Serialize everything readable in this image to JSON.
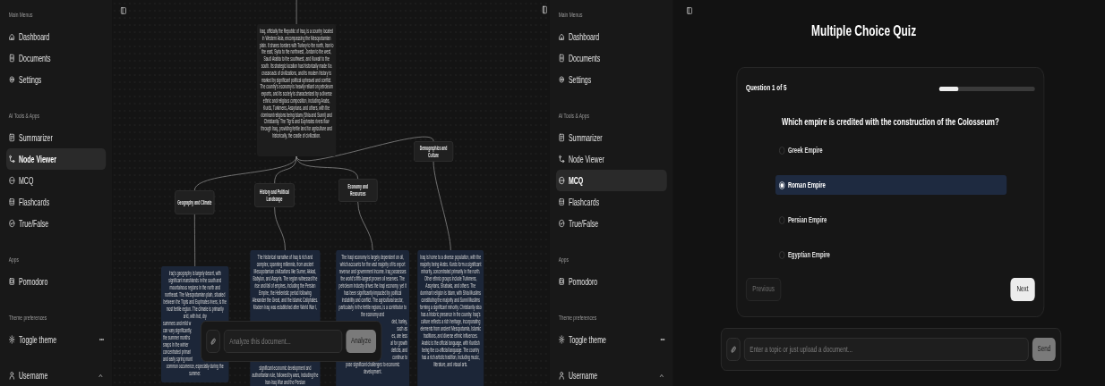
{
  "screens": [
    {
      "kind": "node_viewer",
      "sidebar": {
        "sections": [
          {
            "title": "Main Menus",
            "items": [
              {
                "label": "Dashboard",
                "selected": false
              },
              {
                "label": "Documents",
                "selected": false
              },
              {
                "label": "Settings",
                "selected": false
              }
            ]
          },
          {
            "title": "AI Tools & Apps",
            "items": [
              {
                "label": "Summarizer",
                "selected": false
              },
              {
                "label": "Node Viewer",
                "selected": true
              },
              {
                "label": "MCQ",
                "selected": false
              },
              {
                "label": "Flashcards",
                "selected": false
              },
              {
                "label": "True/False",
                "selected": false
              }
            ]
          },
          {
            "title": "Apps",
            "items": [
              {
                "label": "Pomodoro",
                "selected": false
              }
            ]
          },
          {
            "title": "Theme preferences",
            "items": [
              {
                "label": "Toggle theme",
                "selected": false
              }
            ]
          }
        ],
        "account": {
          "label": "Username"
        }
      },
      "canvas": {
        "root": {
          "kind": "root",
          "text": "Iraq, officially the Republic of Iraq, is a country located in Western Asia, encompassing the Mesopotamian plain. It shares borders with Turkey to the north, Iran to the east, Syria to the northwest, Jordan to the west, Saudi Arabia to the southwest, and Kuwait to the south. Its strategic location has historically made it a crossroads of civilizations, and its modern history is marked by significant political upheaval and conflict. The country's economy is heavily reliant on petroleum exports, and its society is characterized by a diverse ethnic and religious composition, including Arabs, Kurds, Turkmens, Assyrians, and others, with the dominant religions being Islam (Shia and Sunni) and Christianity. The Tigris and Euphrates rivers flow through Iraq, providing fertile land for agriculture and historically, the cradle of civilization.",
          "children": [
            {
              "kind": "topic",
              "text": "Geography and Climate",
              "children": [
                {
                  "kind": "detail",
                  "text": "Iraq's geography is largely desert, with significant marshlands in the south and mountainous regions in the north and northeast. The Mesopotamian plain, situated between the Tigris and Euphrates rivers, is the most fertile region. The climate is primarily arid, with hot, dry",
                  "cut_lines_left": [
                    "summers and mild w",
                    "can vary significantly,",
                    "the summer months",
                    "snaps in the winter",
                    "concentrated primari",
                    "and early spring mont"
                  ],
                  "text_after": "common occurrence, especially during the summer."
                }
              ]
            },
            {
              "kind": "topic",
              "text": "History and Political Landscape",
              "children": [
                {
                  "kind": "detail",
                  "text": "The historical narrative of Iraq is rich and complex, spanning millennia, from ancient Mesopotamian civilizations like Sumer, Akkad, Babylon, and Assyria. The region witnessed the rise and fall of empires, including the Persian Empire, the Hellenistic period following Alexander the Great, and the Islamic Caliphates. Modern Iraq was established after World War I,",
                  "text_after": "significant economic development and authoritarian rule, followed by wars, including the Iran-Iraq War and the Persian"
                }
              ]
            },
            {
              "kind": "topic",
              "text": "Economy and Resources",
              "children": [
                {
                  "kind": "detail",
                  "text": "The Iraqi economy is largely dependent on oil, which accounts for the vast majority of its export revenue and government income. Iraq possesses the world's fifth-largest proven oil reserves. The petroleum industry drives the Iraqi economy, yet it has been significantly impacted by political instability and conflict. The agricultural sector, particularly in the fertile regions, is a contributor to the economy and",
                  "cut_lines_right": [
                    "ded, barley,",
                    "such as",
                    "es, are less",
                    "al for growth",
                    "deficits, and",
                    "continue to"
                  ],
                  "text_after": "pose significant challenges to economic development."
                }
              ]
            },
            {
              "kind": "topic",
              "text": "Demographics and Culture",
              "children": [
                {
                  "kind": "detail",
                  "text": "Iraq is home to a diverse population, with the majority being Arabs. Kurds form a significant minority, concentrated primarily in the north. Other ethnic groups include Turkmens, Assyrians, Shabaks, and others. The dominant religion is Islam, with Shia Muslims constituting the majority and Sunni Muslims forming a significant minority. Christianity also has a historic presence in the country. Iraq's culture reflects a rich heritage, incorporating elements from ancient Mesopotamia, Islamic traditions, and diverse ethnic influences. Arabic is the official language, with Kurdish being the co-official language. The country has a rich artistic tradition, including music, literature, and visual arts."
                }
              ]
            }
          ]
        }
      },
      "prompt": {
        "placeholder": "Analyze this document...",
        "button": {
          "label": "Analyze",
          "disabled": true
        }
      }
    },
    {
      "kind": "quiz",
      "sidebar": {
        "sections": [
          {
            "title": "Main Menus",
            "items": [
              {
                "label": "Dashboard",
                "selected": false
              },
              {
                "label": "Documents",
                "selected": false
              },
              {
                "label": "Settings",
                "selected": false
              }
            ]
          },
          {
            "title": "AI Tools & Apps",
            "items": [
              {
                "label": "Summarizer",
                "selected": false
              },
              {
                "label": "Node Viewer",
                "selected": false
              },
              {
                "label": "MCQ",
                "selected": true
              },
              {
                "label": "Flashcards",
                "selected": false
              },
              {
                "label": "True/False",
                "selected": false
              }
            ]
          },
          {
            "title": "Apps",
            "items": [
              {
                "label": "Pomodoro",
                "selected": false
              }
            ]
          },
          {
            "title": "Theme preferences",
            "items": [
              {
                "label": "Toggle theme",
                "selected": false
              }
            ]
          }
        ],
        "account": {
          "label": "Username"
        }
      },
      "title": "Multiple Choice Quiz",
      "quiz": {
        "progress_label": "Question 1 of 5",
        "level": 0.2,
        "question": "Which empire is credited with the construction of the Colosseum?",
        "options": [
          {
            "label": "Greek Empire",
            "selected": false
          },
          {
            "label": "Roman Empire",
            "selected": true
          },
          {
            "label": "Persian Empire",
            "selected": false
          },
          {
            "label": "Egyptian Empire",
            "selected": false
          }
        ],
        "previous": {
          "label": "Previous",
          "disabled": true
        },
        "next": {
          "label": "Next",
          "disabled": false
        }
      },
      "prompt": {
        "placeholder": "Enter a topic or just upload a document...",
        "button": {
          "label": "Send",
          "disabled": true
        }
      }
    }
  ]
}
